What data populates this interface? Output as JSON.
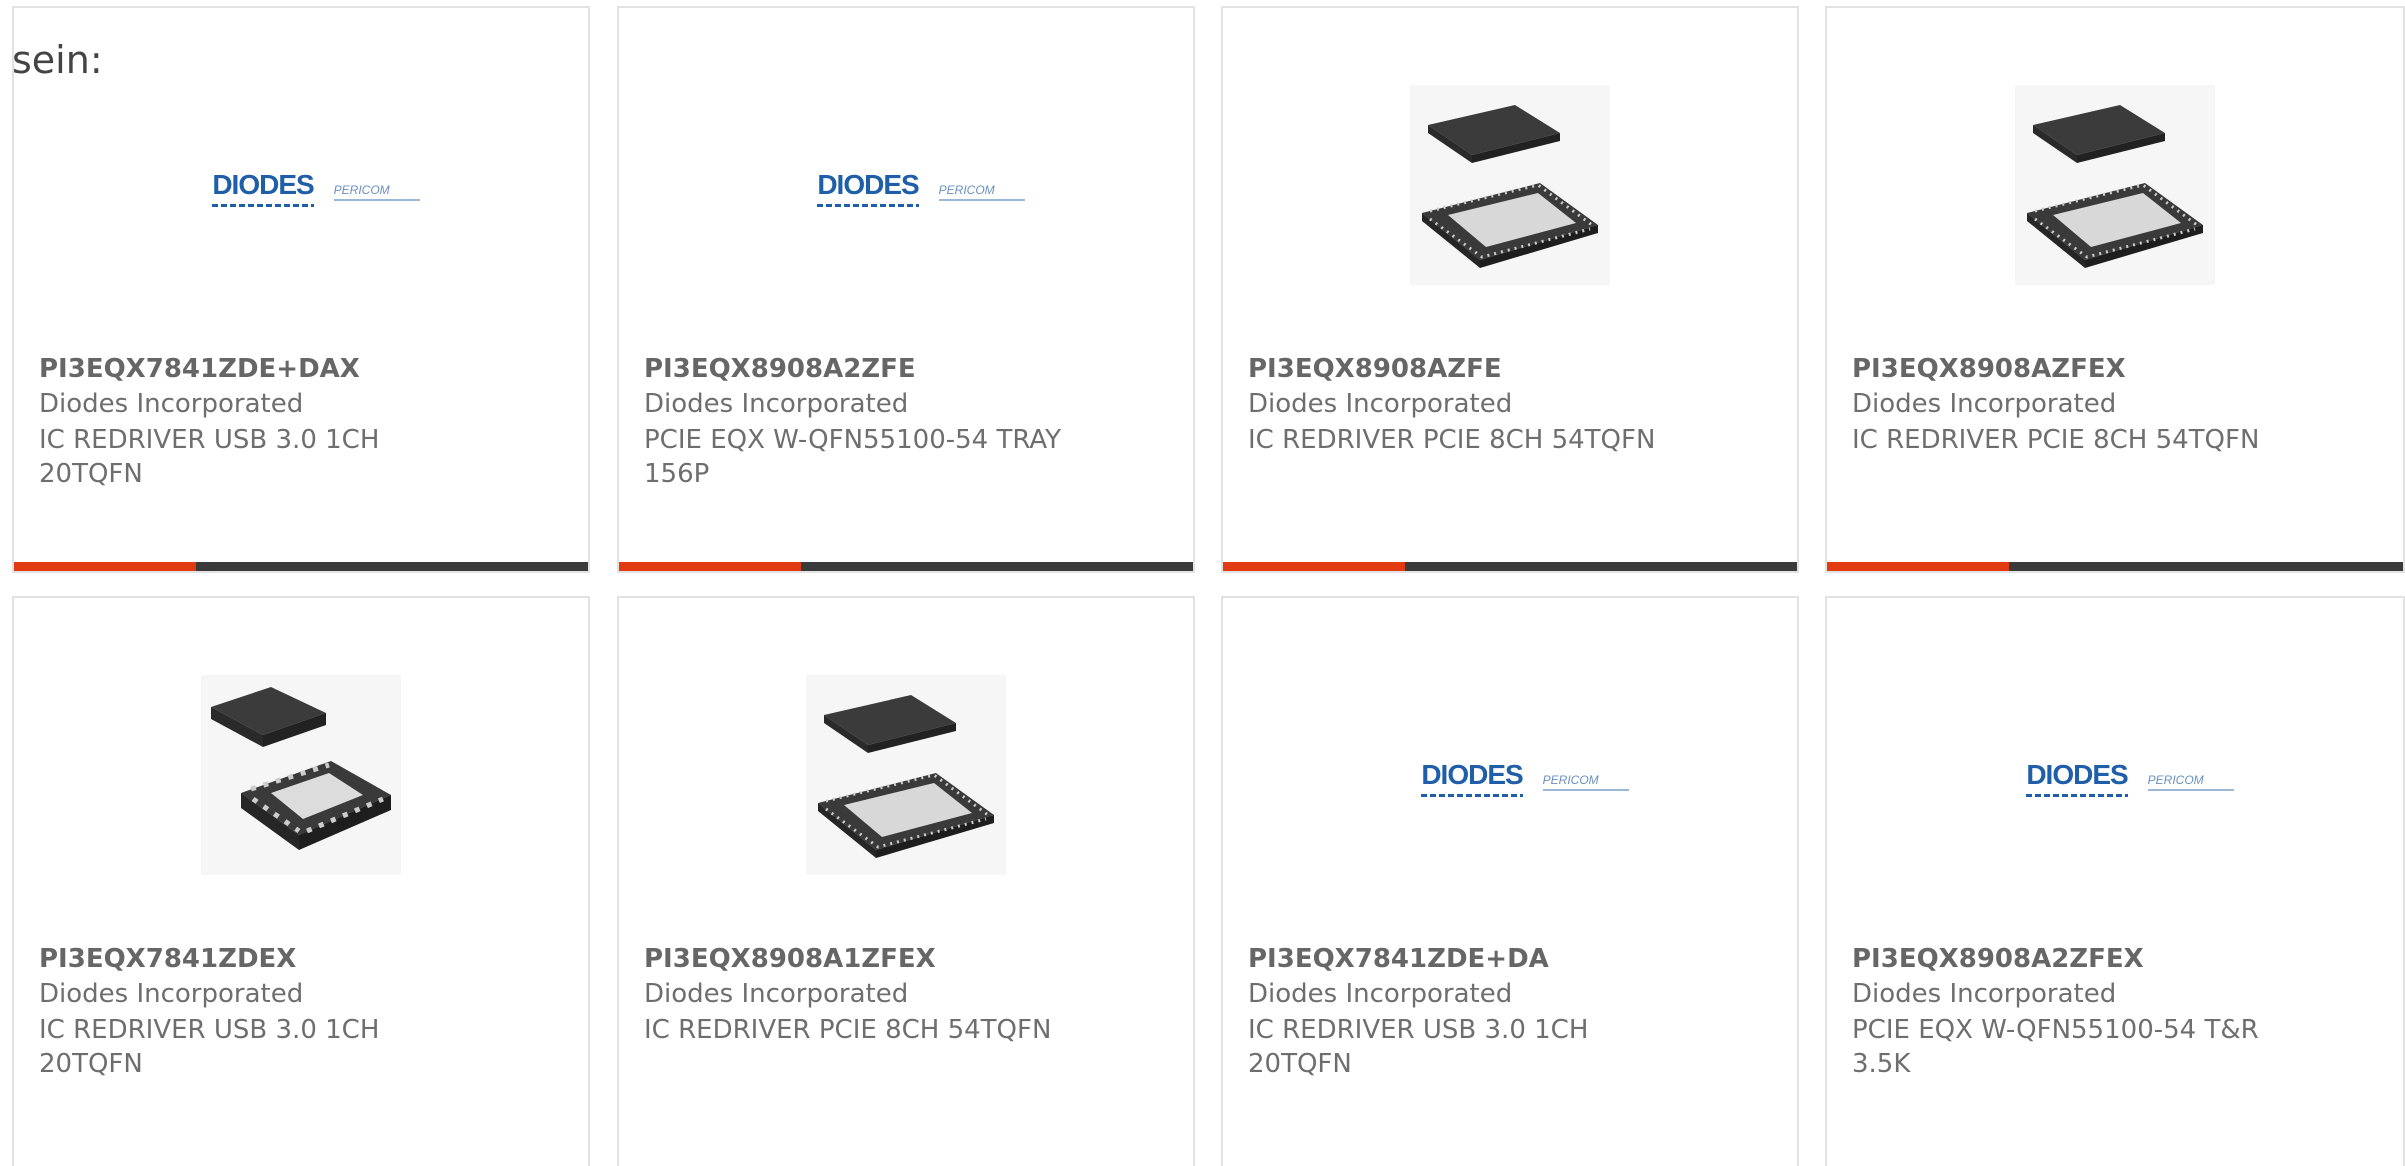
{
  "prefix": "sein:",
  "logo": {
    "brand": "DIODES",
    "sub": "PERICOM"
  },
  "colors": {
    "accent": "#e23b12",
    "bar": "#3a3a3a",
    "logo_blue": "#1f5ea8"
  },
  "products": [
    {
      "part": "PI3EQX7841ZDE+DAX",
      "manufacturer": "Diodes Incorporated",
      "description": "IC REDRIVER USB 3.0 1CH 20TQFN",
      "image": "diodes-logo"
    },
    {
      "part": "PI3EQX8908A2ZFE",
      "manufacturer": "Diodes Incorporated",
      "description": "PCIE EQX W-QFN55100-54 TRAY 156P",
      "image": "diodes-logo"
    },
    {
      "part": "PI3EQX8908AZFE",
      "manufacturer": "Diodes Incorporated",
      "description": "IC REDRIVER PCIE 8CH 54TQFN",
      "image": "qfn-54-chip"
    },
    {
      "part": "PI3EQX8908AZFEX",
      "manufacturer": "Diodes Incorporated",
      "description": "IC REDRIVER PCIE 8CH 54TQFN",
      "image": "qfn-54-chip"
    },
    {
      "part": "PI3EQX7841ZDEX",
      "manufacturer": "Diodes Incorporated",
      "description": "IC REDRIVER USB 3.0 1CH 20TQFN",
      "image": "qfn-20-chip"
    },
    {
      "part": "PI3EQX8908A1ZFEX",
      "manufacturer": "Diodes Incorporated",
      "description": "IC REDRIVER PCIE 8CH 54TQFN",
      "image": "qfn-54-chip"
    },
    {
      "part": "PI3EQX7841ZDE+DA",
      "manufacturer": "Diodes Incorporated",
      "description": "IC REDRIVER USB 3.0 1CH 20TQFN",
      "image": "diodes-logo"
    },
    {
      "part": "PI3EQX8908A2ZFEX",
      "manufacturer": "Diodes Incorporated",
      "description": "PCIE EQX W-QFN55100-54 T&R 3.5K",
      "image": "diodes-logo"
    }
  ]
}
